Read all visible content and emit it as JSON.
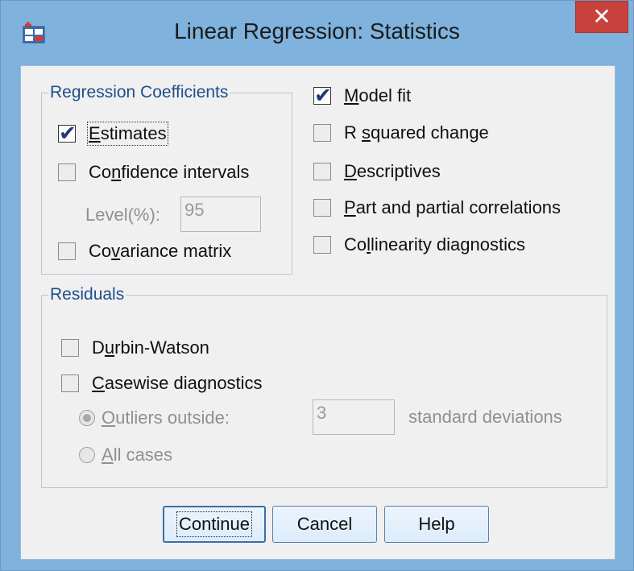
{
  "window": {
    "title": "Linear Regression: Statistics",
    "close_label": "✕"
  },
  "regression_coefficients": {
    "legend": "Regression Coefficients",
    "estimates": {
      "pre": "",
      "accel": "E",
      "post": "stimates",
      "checked": true
    },
    "confidence": {
      "pre": "Co",
      "accel": "n",
      "post": "fidence intervals",
      "checked": false
    },
    "level_label": "Level(%):",
    "level_value": "95",
    "covariance": {
      "pre": "Co",
      "accel": "v",
      "post": "ariance matrix",
      "checked": false
    }
  },
  "right_options": {
    "model_fit": {
      "pre": "",
      "accel": "M",
      "post": "odel fit",
      "checked": true
    },
    "r_squared": {
      "pre": "R ",
      "accel": "s",
      "post": "quared change",
      "checked": false
    },
    "descriptives": {
      "pre": "",
      "accel": "D",
      "post": "escriptives",
      "checked": false
    },
    "part_partial": {
      "pre": "",
      "accel": "P",
      "post": "art and partial correlations",
      "checked": false
    },
    "collinearity": {
      "pre": "Co",
      "accel": "l",
      "post": "linearity diagnostics",
      "checked": false
    }
  },
  "residuals": {
    "legend": "Residuals",
    "durbin": {
      "pre": "D",
      "accel": "u",
      "post": "rbin-Watson",
      "checked": false
    },
    "casewise": {
      "pre": "",
      "accel": "C",
      "post": "asewise diagnostics",
      "checked": false
    },
    "outliers": {
      "pre": "",
      "accel": "O",
      "post": "utliers outside:",
      "selected": true
    },
    "outliers_value": "3",
    "std_dev_label": "standard deviations",
    "all_cases": {
      "pre": "",
      "accel": "A",
      "post": "ll cases",
      "selected": false
    }
  },
  "buttons": {
    "continue_label": "Continue",
    "cancel_label": "Cancel",
    "help_label": "Help"
  },
  "colors": {
    "titlebar": "#7fb2dc",
    "close": "#c7413d",
    "legend_text": "#1f4f8c",
    "checkmark": "#1f3a7a"
  }
}
